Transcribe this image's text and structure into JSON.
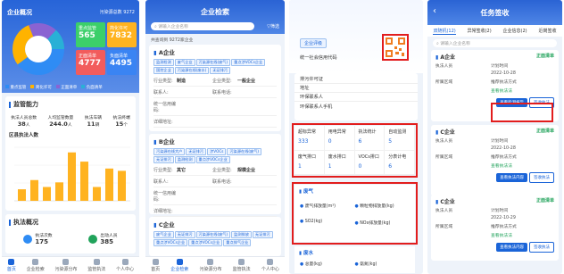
{
  "p1": {
    "title": "企业概况",
    "corner": "污染源总数 9272",
    "legend": [
      {
        "label": "重点监管",
        "color": "#2f8cf4"
      },
      {
        "label": "简化排污",
        "color": "#ffb300"
      },
      {
        "label": "登记管理",
        "color": "#8a63d2"
      },
      {
        "label": "非重点单位",
        "color": "#29b0d6"
      }
    ],
    "tiles": [
      {
        "label": "重点监管",
        "value": "565",
        "color": "#3ccf6a"
      },
      {
        "label": "简化许可",
        "value": "7832",
        "color": "#ffb320"
      },
      {
        "label": "正面清单",
        "value": "4777",
        "color": "#f25c5c"
      },
      {
        "label": "负面清单",
        "value": "4495",
        "color": "#3a84f3"
      }
    ],
    "legend2": [
      {
        "label": "重点监管",
        "color": "#2f8cf4"
      },
      {
        "label": "简化许可",
        "color": "#ffb300"
      },
      {
        "label": "正面清单",
        "color": "#8a63d2"
      },
      {
        "label": "负面清单",
        "color": "#29b0d6"
      }
    ],
    "sv_title": "监管能力",
    "stats": [
      {
        "label": "执法人员总数",
        "value": "38",
        "unit": "人"
      },
      {
        "label": "人均监管数量",
        "value": "244.0",
        "unit": "人"
      },
      {
        "label": "执法车辆",
        "value": "11",
        "unit": "辆"
      },
      {
        "label": "执法终端",
        "value": "15",
        "unit": "个"
      }
    ],
    "district_title": "区县执法人数",
    "ex_title": "执法概况",
    "ex": [
      {
        "label": "执法次数",
        "value": "175",
        "color": "#2f8cf4"
      },
      {
        "label": "出动人员",
        "value": "385",
        "color": "#21a35b"
      }
    ],
    "nav": [
      "首页",
      "企业检索",
      "污染源分布",
      "监管执法",
      "个人中心"
    ],
    "nav_on": 0
  },
  "chart_data": {
    "type": "bar",
    "values": [
      5,
      9,
      6,
      8,
      21,
      17,
      6,
      14,
      13
    ],
    "title": "区县执法人数"
  },
  "p2": {
    "title": "企业检索",
    "placeholder": "请输入企业名称",
    "filter": "筛选",
    "count": "共查询到 9272家企业",
    "companies": [
      {
        "name": "A企业",
        "tags": [
          "监测检测",
          "废气企业",
          "污染源在线(废气)",
          "重点涉VOCs企业",
          "国控企业",
          "污染源在线(废水)",
          "无证排污"
        ],
        "rows": [
          [
            "行业类型:",
            "制造",
            "企业类型:",
            "一般企业"
          ],
          [
            "联系人:",
            "",
            "联系电话:",
            ""
          ],
          [
            "统一信用编码:",
            "",
            "",
            ""
          ],
          [
            "详细地址:",
            "",
            "",
            ""
          ]
        ]
      },
      {
        "name": "B企业",
        "tags": [
          "污染源在线大户",
          "无证排污",
          "涉VOCs",
          "污染源在线(废气)",
          "无证排污",
          "监测检测",
          "重点涉VOCs企业"
        ],
        "rows": [
          [
            "行业类型:",
            "其它",
            "企业类型:",
            "规模企业"
          ],
          [
            "联系人:",
            "",
            "联系电话:",
            ""
          ],
          [
            "统一信用编码:",
            "",
            "",
            ""
          ],
          [
            "详细地址:",
            "",
            "",
            ""
          ]
        ]
      },
      {
        "name": "C企业",
        "tags": [
          "废气企业",
          "无证排污",
          "污染源在线(废气)",
          "监测排放",
          "无证排污",
          "重点涉VOCs企业",
          "重点涉VOCs企业",
          "重点排气企业"
        ],
        "rows": []
      }
    ],
    "nav": [
      "首页",
      "企业检索",
      "污染源分布",
      "监管执法",
      "个人中心"
    ],
    "nav_on": 1
  },
  "p3": {
    "eval": "企业评级",
    "credit": "统一社会信用代码",
    "info": [
      "排污许可证",
      "地址",
      "环保联系人",
      "环保联系人手机"
    ],
    "grid": [
      {
        "label": "超标异常",
        "value": "333"
      },
      {
        "label": "用电异常",
        "value": "0"
      },
      {
        "label": "执法统计",
        "value": "6"
      },
      {
        "label": "自动监测",
        "value": "5"
      },
      {
        "label": "废气排口",
        "value": "1"
      },
      {
        "label": "废水排口",
        "value": "1"
      },
      {
        "label": "VOCs排口",
        "value": "0"
      },
      {
        "label": "分表计电",
        "value": "6"
      }
    ],
    "gas_title": "废气",
    "gas": [
      "废气排放量(m³)",
      "颗粒物排放量(kg)",
      "SO2(kg)",
      "NOx排放量(kg)"
    ],
    "water_title": "废水",
    "water": [
      "总量(kg)",
      "氨氮(kg)"
    ]
  },
  "p4": {
    "title": "任务签收",
    "tabs": [
      "双随机(12)",
      "异常签收(2)",
      "企业信息(2)",
      "近岗签收"
    ],
    "placeholder": "请输入企业名称",
    "tasks": [
      {
        "name": "A企业",
        "status": "正面清单",
        "lines": [
          [
            "执法人员",
            "计划时间"
          ],
          [
            "",
            "2022-10-28"
          ],
          [
            "所属区域",
            "推荐执法方式"
          ],
          [
            "",
            "查看执法法"
          ]
        ],
        "b1": "查看检测报告",
        "b2": "签收执法"
      },
      {
        "name": "C企业",
        "status": "正面清单",
        "lines": [
          [
            "执法人员",
            "计划时间"
          ],
          [
            "",
            "2022-10-28"
          ],
          [
            "所属区域",
            "推荐执法方式"
          ],
          [
            "",
            "查看执法法"
          ]
        ],
        "b1": "查看执法内容",
        "b2": "签收执法"
      },
      {
        "name": "C企业",
        "status": "正面清单",
        "lines": [
          [
            "执法人员",
            "计划时间"
          ],
          [
            "",
            "2022-10-29"
          ],
          [
            "所属区域",
            "推荐执法方式"
          ],
          [
            "",
            "查看执法法"
          ]
        ],
        "b1": "查看执法内容",
        "b2": "签收执法"
      }
    ]
  }
}
